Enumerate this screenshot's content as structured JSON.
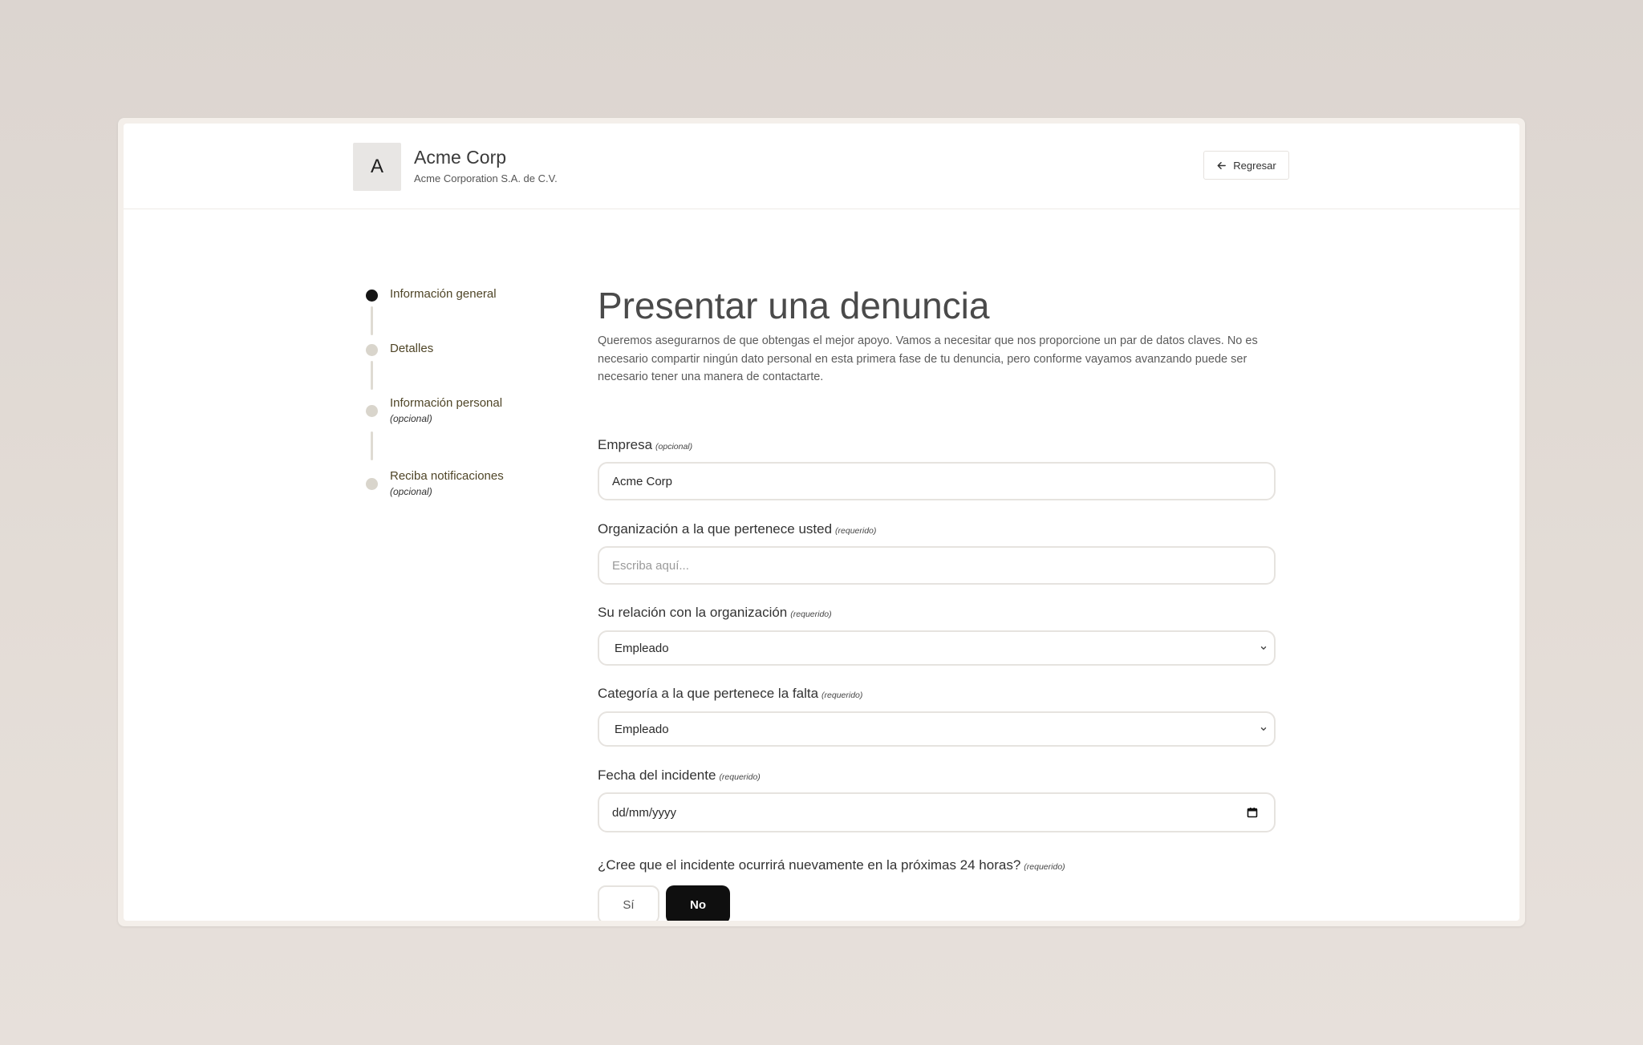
{
  "header": {
    "logo_letter": "A",
    "company_name": "Acme Corp",
    "company_legal": "Acme Corporation S.A. de C.V.",
    "back_label": "Regresar"
  },
  "stepper": {
    "steps": [
      {
        "label": "Información general",
        "sub": "",
        "active": true
      },
      {
        "label": "Detalles",
        "sub": "",
        "active": false
      },
      {
        "label": "Información personal",
        "sub": "(opcional)",
        "active": false
      },
      {
        "label": "Reciba notificaciones",
        "sub": "(opcional)",
        "active": false
      }
    ]
  },
  "main": {
    "title": "Presentar una denuncia",
    "intro": "Queremos asegurarnos de que obtengas el mejor apoyo. Vamos a necesitar que nos proporcione un par de datos claves. No es necesario compartir ningún dato personal en esta primera fase de tu denuncia, pero conforme vayamos avanzando puede ser necesario tener una manera de contactarte."
  },
  "form": {
    "empresa": {
      "label": "Empresa",
      "tag": "(opcional)",
      "value": "Acme Corp"
    },
    "organizacion": {
      "label": "Organización a la que pertenece usted",
      "tag": "(requerido)",
      "placeholder": "Escriba aquí..."
    },
    "relacion": {
      "label": "Su relación con la organización",
      "tag": "(requerido)",
      "value": "Empleado"
    },
    "categoria": {
      "label": "Categoría a la que pertenece la falta",
      "tag": "(requerido)",
      "value": "Empleado"
    },
    "fecha": {
      "label": "Fecha del incidente",
      "tag": "(requerido)",
      "value": "dd/mm/yyyy"
    },
    "recurrencia": {
      "label": "¿Cree que el incidente ocurrirá nuevamente en la próximas 24 horas?",
      "tag": "(requerido)",
      "yes_label": "Sí",
      "no_label": "No",
      "selected": "No"
    }
  },
  "colors": {
    "active_step": "#151515",
    "inactive_step": "#d9d5cc",
    "selected_choice": "#0f0f0f"
  }
}
